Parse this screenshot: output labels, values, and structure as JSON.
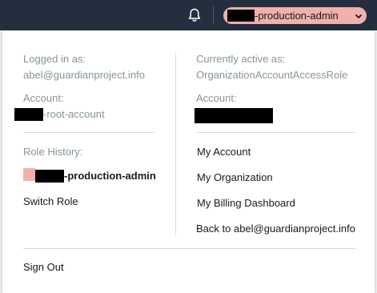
{
  "navbar": {
    "bell_icon": "bell-icon",
    "role_button": {
      "role_suffix": "-production-admin",
      "color": "#f2b0aa",
      "caret_icon": "caret-down-icon"
    }
  },
  "menu": {
    "logged_in": {
      "label": "Logged in as:",
      "value": "abel@guardianproject.info"
    },
    "account_left": {
      "label": "Account:",
      "value_suffix": "-root-account"
    },
    "role_history": {
      "label": "Role History:",
      "entry_suffix": "-production-admin",
      "entry_color": "#f2b0aa"
    },
    "switch_role": "Switch Role",
    "active": {
      "label": "Currently active as:",
      "value": "OrganizationAccountAccessRole"
    },
    "account_right": {
      "label": "Account:"
    },
    "links": [
      "My Account",
      "My Organization",
      "My Billing Dashboard",
      "Back to abel@guardianproject.info"
    ],
    "sign_out": "Sign Out"
  }
}
